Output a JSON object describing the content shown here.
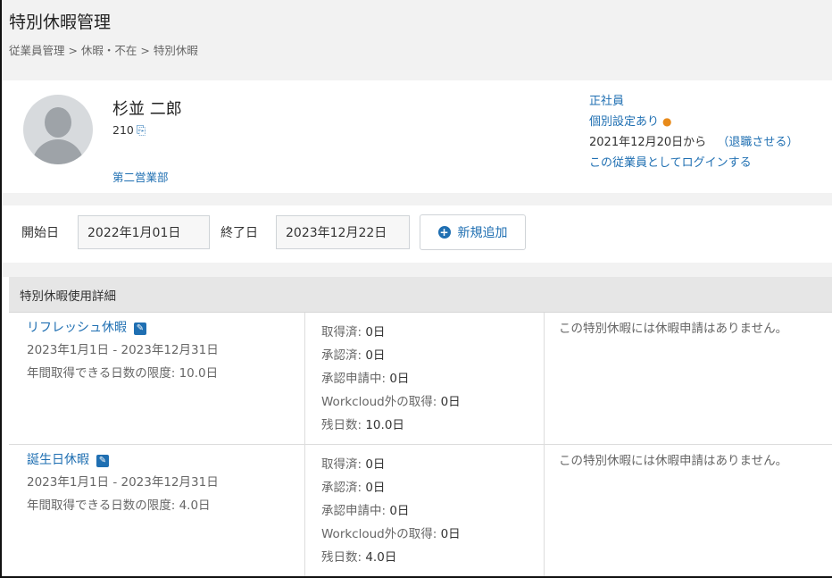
{
  "page": {
    "title": "特別休暇管理",
    "breadcrumb": "従業員管理 > 休暇・不在 > 特別休暇"
  },
  "employee": {
    "name": "杉並 二郎",
    "id": "210",
    "department": "第二営業部",
    "clipped_text": "…",
    "employment_type": "正社員",
    "individual_setting": "個別設定あり",
    "start_date_text": "2021年12月20日から",
    "retire_link": "（退職させる）",
    "login_as_link": "この従業員としてログインする"
  },
  "filter": {
    "start_label": "開始日",
    "start_value": "2022年1月01日",
    "end_label": "終了日",
    "end_value": "2023年12月22日",
    "add_button": "新規追加"
  },
  "section": {
    "title": "特別休暇使用詳細"
  },
  "leaves": [
    {
      "name": "リフレッシュ休暇",
      "period": "2023年1月1日 - 2023年12月31日",
      "limit": "年間取得できる日数の限度: 10.0日",
      "stats": {
        "acquired_label": "取得済: ",
        "acquired_value": "0日",
        "approved_label": "承認済: ",
        "approved_value": "0日",
        "pending_label": "承認申請中: ",
        "pending_value": "0日",
        "outside_label": "Workcloud外の取得: ",
        "outside_value": "0日",
        "remaining_label": "残日数: ",
        "remaining_value": "10.0日"
      },
      "note": "この特別休暇には休暇申請はありません。"
    },
    {
      "name": "誕生日休暇",
      "period": "2023年1月1日 - 2023年12月31日",
      "limit": "年間取得できる日数の限度: 4.0日",
      "stats": {
        "acquired_label": "取得済: ",
        "acquired_value": "0日",
        "approved_label": "承認済: ",
        "approved_value": "0日",
        "pending_label": "承認申請中: ",
        "pending_value": "0日",
        "outside_label": "Workcloud外の取得: ",
        "outside_value": "0日",
        "remaining_label": "残日数: ",
        "remaining_value": "4.0日"
      },
      "note": "この特別休暇には休暇申請はありません。"
    }
  ],
  "icons": {
    "copy": "copy-icon",
    "person": "person-icon",
    "plus": "plus-circle-icon",
    "edit": "edit-icon"
  },
  "colors": {
    "link": "#1f6fb2",
    "accent_orange": "#e88a1a",
    "header_bg": "#f2f2f2"
  }
}
